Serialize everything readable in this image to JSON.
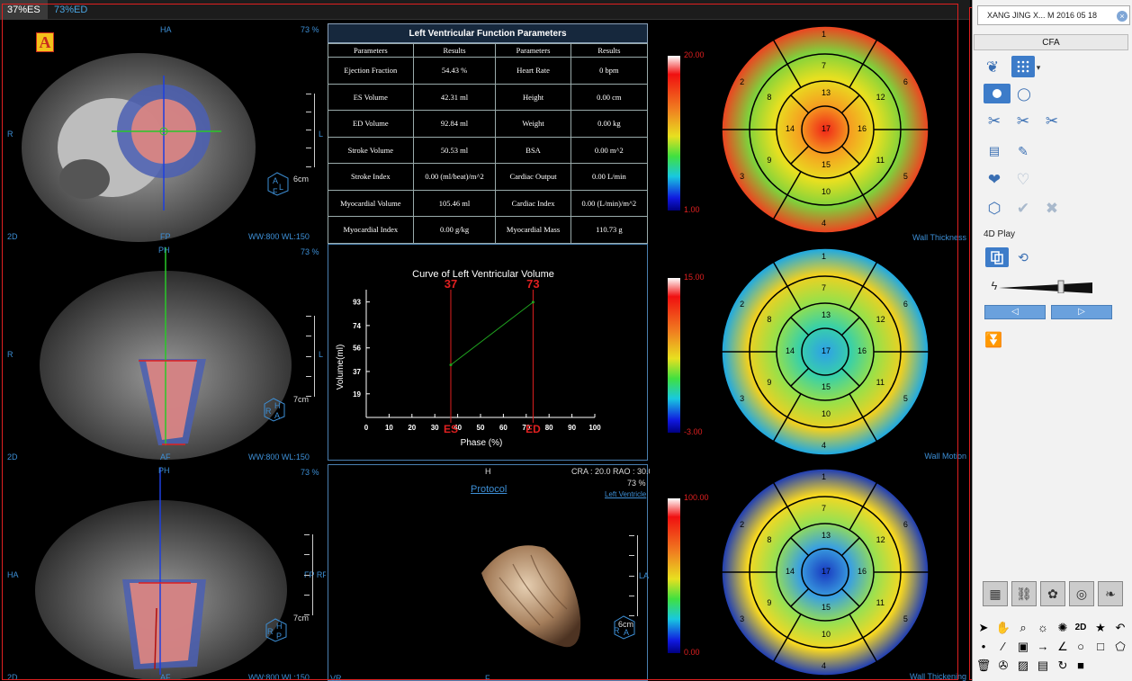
{
  "tabs": [
    {
      "label": "37%ES"
    },
    {
      "label": "73%ED"
    }
  ],
  "tags": {
    "a": "A",
    "b": "B"
  },
  "views": {
    "axial": {
      "top": "HA",
      "left": "R",
      "right": "L",
      "bottom": "FP",
      "pct": "73 %",
      "mode": "2D",
      "wwwl": "WW:800 WL:150",
      "scale": "6cm",
      "cube": [
        "A",
        "L",
        "F"
      ]
    },
    "long": {
      "top": "PH",
      "left": "R",
      "right": "L",
      "bottom": "AF",
      "pct": "73 %",
      "mode": "2D",
      "wwwl": "WW:800 WL:150",
      "scale": "7cm",
      "cube": [
        "H",
        "R",
        "A"
      ]
    },
    "short": {
      "top": "PH",
      "left": "HA",
      "right": "FP RP",
      "bottom": "AF",
      "pct": "73 %",
      "mode": "2D",
      "wwwl": "WW:800 WL:150",
      "scale": "7cm",
      "cube": [
        "H",
        "R",
        "P"
      ]
    }
  },
  "params": {
    "title": "Left Ventricular Function Parameters",
    "headers": [
      "Parameters",
      "Results",
      "Parameters",
      "Results"
    ],
    "rows": [
      [
        "Ejection Fraction",
        "54.43 %",
        "Heart Rate",
        "0 bpm"
      ],
      [
        "ES Volume",
        "42.31 ml",
        "Height",
        "0.00 cm"
      ],
      [
        "ED Volume",
        "92.84 ml",
        "Weight",
        "0.00 kg"
      ],
      [
        "Stroke Volume",
        "50.53 ml",
        "BSA",
        "0.00 m^2"
      ],
      [
        "Stroke Index",
        "0.00 (ml/beat)/m^2",
        "Cardiac Output",
        "0.00 L/min"
      ],
      [
        "Myocardial Volume",
        "105.46 ml",
        "Cardiac Index",
        "0.00 (L/min)/m^2"
      ],
      [
        "Myocardial Index",
        "0.00 g/kg",
        "Myocardial Mass",
        "110.73 g"
      ]
    ]
  },
  "chart_data": {
    "type": "line",
    "title": "Curve of Left Ventricular Volume",
    "xlabel": "Phase (%)",
    "ylabel": "Volume(ml)",
    "xlim": [
      0,
      100
    ],
    "ylim": [
      0,
      100
    ],
    "x_ticks": [
      "0",
      "10",
      "20",
      "30",
      "40",
      "50",
      "60",
      "70",
      "80",
      "90",
      "100"
    ],
    "y_ticks": [
      "19",
      "37",
      "56",
      "74",
      "93"
    ],
    "series": [
      {
        "x": [
          37,
          73
        ],
        "values": [
          42.31,
          92.84
        ]
      }
    ],
    "markers": [
      {
        "x": 37,
        "label": "37",
        "bottom_label": "ES"
      },
      {
        "x": 73,
        "label": "73",
        "bottom_label": "ED"
      }
    ],
    "colors": {
      "line": "#1fa31f",
      "marker": "#e02020"
    }
  },
  "protocol": {
    "link": "Protocol",
    "top": "H",
    "angles": "CRA : 20.0  RAO : 30.0",
    "pct": "73 %",
    "region": "Left Ventricle",
    "left": "",
    "right": "LA",
    "bottom": "F",
    "mode": "VR",
    "scale": "6cm",
    "cube": [
      "R",
      "A"
    ]
  },
  "bullseyes": [
    {
      "title": "Wall Thickness",
      "max": "20.00",
      "min": "1.00"
    },
    {
      "title": "Wall Motion",
      "max": "15.00",
      "min": "-3.00"
    },
    {
      "title": "Wall Thickening",
      "max": "100.00",
      "min": "0.00"
    }
  ],
  "segments": {
    "outer": [
      "1",
      "6",
      "5",
      "4",
      "3",
      "2"
    ],
    "mid": [
      "7",
      "12",
      "11",
      "10",
      "9",
      "8"
    ],
    "inner": [
      "13",
      "16",
      "15",
      "14"
    ],
    "apex": "17"
  },
  "sidebar": {
    "patient": "XANG JING X... M 2016 05 18",
    "close": "×",
    "panel_title": "CFA",
    "play_label": "4D Play",
    "prev_label": "◁",
    "next_label": "▷"
  }
}
